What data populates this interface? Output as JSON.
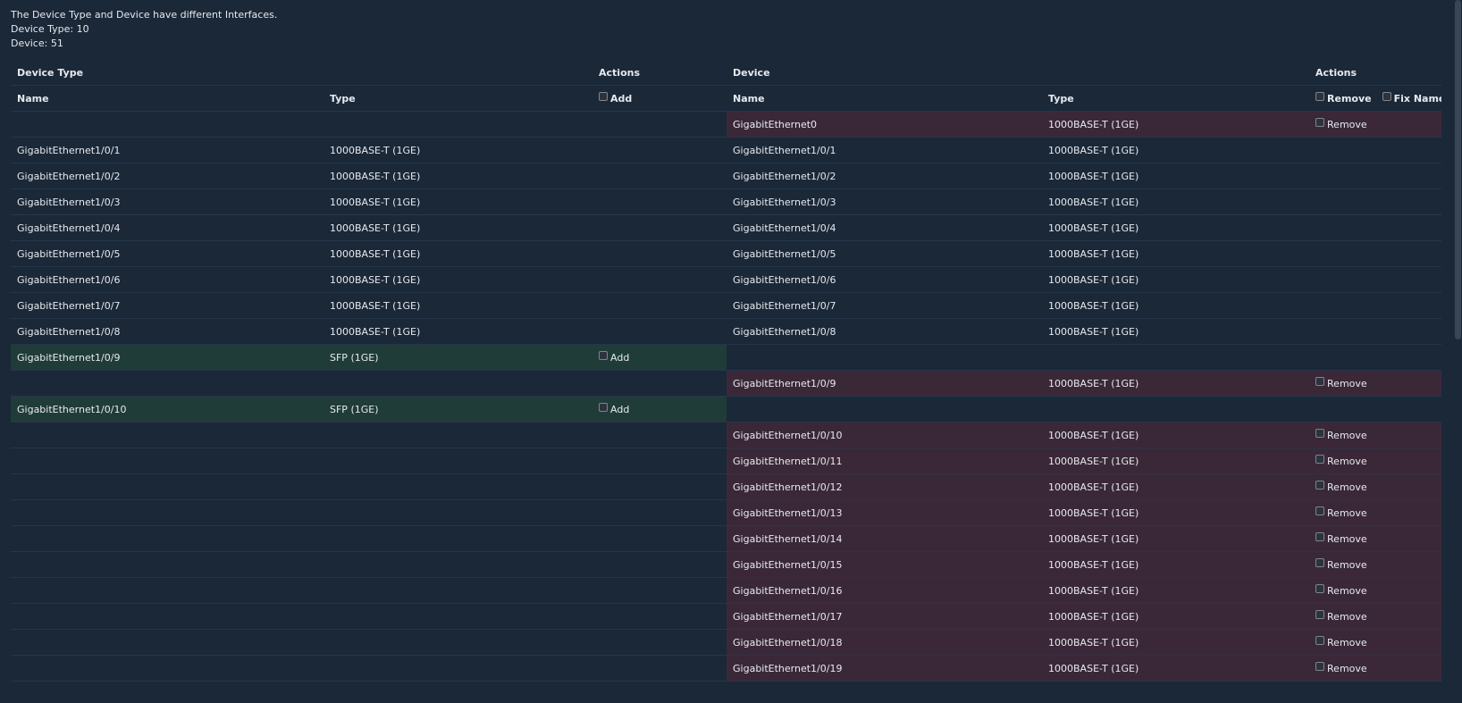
{
  "summary": {
    "message": "The Device Type and Device have different Interfaces.",
    "device_type_line": "Device Type: 10",
    "device_line": "Device: 51"
  },
  "headers": {
    "device_type": "Device Type",
    "device": "Device",
    "actions": "Actions",
    "name": "Name",
    "type": "Type",
    "add": "Add",
    "remove": "Remove",
    "fix_name": "Fix Name"
  },
  "rows": [
    {
      "left_name": "",
      "left_type": "",
      "left_action": "",
      "right_name": "GigabitEthernet0",
      "right_type": "1000BASE-T (1GE)",
      "right_action": "Remove",
      "left_status": "",
      "right_status": "remove"
    },
    {
      "left_name": "GigabitEthernet1/0/1",
      "left_type": "1000BASE-T (1GE)",
      "left_action": "",
      "right_name": "GigabitEthernet1/0/1",
      "right_type": "1000BASE-T (1GE)",
      "right_action": "",
      "left_status": "",
      "right_status": ""
    },
    {
      "left_name": "GigabitEthernet1/0/2",
      "left_type": "1000BASE-T (1GE)",
      "left_action": "",
      "right_name": "GigabitEthernet1/0/2",
      "right_type": "1000BASE-T (1GE)",
      "right_action": "",
      "left_status": "",
      "right_status": ""
    },
    {
      "left_name": "GigabitEthernet1/0/3",
      "left_type": "1000BASE-T (1GE)",
      "left_action": "",
      "right_name": "GigabitEthernet1/0/3",
      "right_type": "1000BASE-T (1GE)",
      "right_action": "",
      "left_status": "",
      "right_status": ""
    },
    {
      "left_name": "GigabitEthernet1/0/4",
      "left_type": "1000BASE-T (1GE)",
      "left_action": "",
      "right_name": "GigabitEthernet1/0/4",
      "right_type": "1000BASE-T (1GE)",
      "right_action": "",
      "left_status": "",
      "right_status": ""
    },
    {
      "left_name": "GigabitEthernet1/0/5",
      "left_type": "1000BASE-T (1GE)",
      "left_action": "",
      "right_name": "GigabitEthernet1/0/5",
      "right_type": "1000BASE-T (1GE)",
      "right_action": "",
      "left_status": "",
      "right_status": ""
    },
    {
      "left_name": "GigabitEthernet1/0/6",
      "left_type": "1000BASE-T (1GE)",
      "left_action": "",
      "right_name": "GigabitEthernet1/0/6",
      "right_type": "1000BASE-T (1GE)",
      "right_action": "",
      "left_status": "",
      "right_status": ""
    },
    {
      "left_name": "GigabitEthernet1/0/7",
      "left_type": "1000BASE-T (1GE)",
      "left_action": "",
      "right_name": "GigabitEthernet1/0/7",
      "right_type": "1000BASE-T (1GE)",
      "right_action": "",
      "left_status": "",
      "right_status": ""
    },
    {
      "left_name": "GigabitEthernet1/0/8",
      "left_type": "1000BASE-T (1GE)",
      "left_action": "",
      "right_name": "GigabitEthernet1/0/8",
      "right_type": "1000BASE-T (1GE)",
      "right_action": "",
      "left_status": "",
      "right_status": ""
    },
    {
      "left_name": "GigabitEthernet1/0/9",
      "left_type": "SFP (1GE)",
      "left_action": "Add",
      "right_name": "",
      "right_type": "",
      "right_action": "",
      "left_status": "add",
      "right_status": ""
    },
    {
      "left_name": "",
      "left_type": "",
      "left_action": "",
      "right_name": "GigabitEthernet1/0/9",
      "right_type": "1000BASE-T (1GE)",
      "right_action": "Remove",
      "left_status": "",
      "right_status": "remove"
    },
    {
      "left_name": "GigabitEthernet1/0/10",
      "left_type": "SFP (1GE)",
      "left_action": "Add",
      "right_name": "",
      "right_type": "",
      "right_action": "",
      "left_status": "add",
      "right_status": ""
    },
    {
      "left_name": "",
      "left_type": "",
      "left_action": "",
      "right_name": "GigabitEthernet1/0/10",
      "right_type": "1000BASE-T (1GE)",
      "right_action": "Remove",
      "left_status": "",
      "right_status": "remove"
    },
    {
      "left_name": "",
      "left_type": "",
      "left_action": "",
      "right_name": "GigabitEthernet1/0/11",
      "right_type": "1000BASE-T (1GE)",
      "right_action": "Remove",
      "left_status": "",
      "right_status": "remove"
    },
    {
      "left_name": "",
      "left_type": "",
      "left_action": "",
      "right_name": "GigabitEthernet1/0/12",
      "right_type": "1000BASE-T (1GE)",
      "right_action": "Remove",
      "left_status": "",
      "right_status": "remove"
    },
    {
      "left_name": "",
      "left_type": "",
      "left_action": "",
      "right_name": "GigabitEthernet1/0/13",
      "right_type": "1000BASE-T (1GE)",
      "right_action": "Remove",
      "left_status": "",
      "right_status": "remove"
    },
    {
      "left_name": "",
      "left_type": "",
      "left_action": "",
      "right_name": "GigabitEthernet1/0/14",
      "right_type": "1000BASE-T (1GE)",
      "right_action": "Remove",
      "left_status": "",
      "right_status": "remove"
    },
    {
      "left_name": "",
      "left_type": "",
      "left_action": "",
      "right_name": "GigabitEthernet1/0/15",
      "right_type": "1000BASE-T (1GE)",
      "right_action": "Remove",
      "left_status": "",
      "right_status": "remove"
    },
    {
      "left_name": "",
      "left_type": "",
      "left_action": "",
      "right_name": "GigabitEthernet1/0/16",
      "right_type": "1000BASE-T (1GE)",
      "right_action": "Remove",
      "left_status": "",
      "right_status": "remove"
    },
    {
      "left_name": "",
      "left_type": "",
      "left_action": "",
      "right_name": "GigabitEthernet1/0/17",
      "right_type": "1000BASE-T (1GE)",
      "right_action": "Remove",
      "left_status": "",
      "right_status": "remove"
    },
    {
      "left_name": "",
      "left_type": "",
      "left_action": "",
      "right_name": "GigabitEthernet1/0/18",
      "right_type": "1000BASE-T (1GE)",
      "right_action": "Remove",
      "left_status": "",
      "right_status": "remove"
    },
    {
      "left_name": "",
      "left_type": "",
      "left_action": "",
      "right_name": "GigabitEthernet1/0/19",
      "right_type": "1000BASE-T (1GE)",
      "right_action": "Remove",
      "left_status": "",
      "right_status": "remove"
    }
  ]
}
